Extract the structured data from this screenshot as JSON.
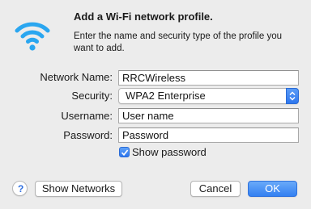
{
  "dialog": {
    "title": "Add a Wi-Fi network profile.",
    "subtitle": "Enter the name and security type of the profile you want to add."
  },
  "form": {
    "network_name_label": "Network Name:",
    "network_name_value": "RRCWireless",
    "security_label": "Security:",
    "security_value": "WPA2 Enterprise",
    "username_label": "Username:",
    "username_value": "User name",
    "password_label": "Password:",
    "password_value": "Password",
    "show_password_label": "Show password",
    "show_password_checked": true
  },
  "buttons": {
    "help": "?",
    "show_networks": "Show Networks",
    "cancel": "Cancel",
    "ok": "OK"
  },
  "icons": {
    "wifi": "wifi-icon",
    "select_arrows": "chevron-up-down-icon",
    "checkmark": "checkmark-icon"
  },
  "colors": {
    "accent": "#2f7bf0",
    "wifi_icon": "#2aa6f0",
    "background": "#ececec"
  }
}
